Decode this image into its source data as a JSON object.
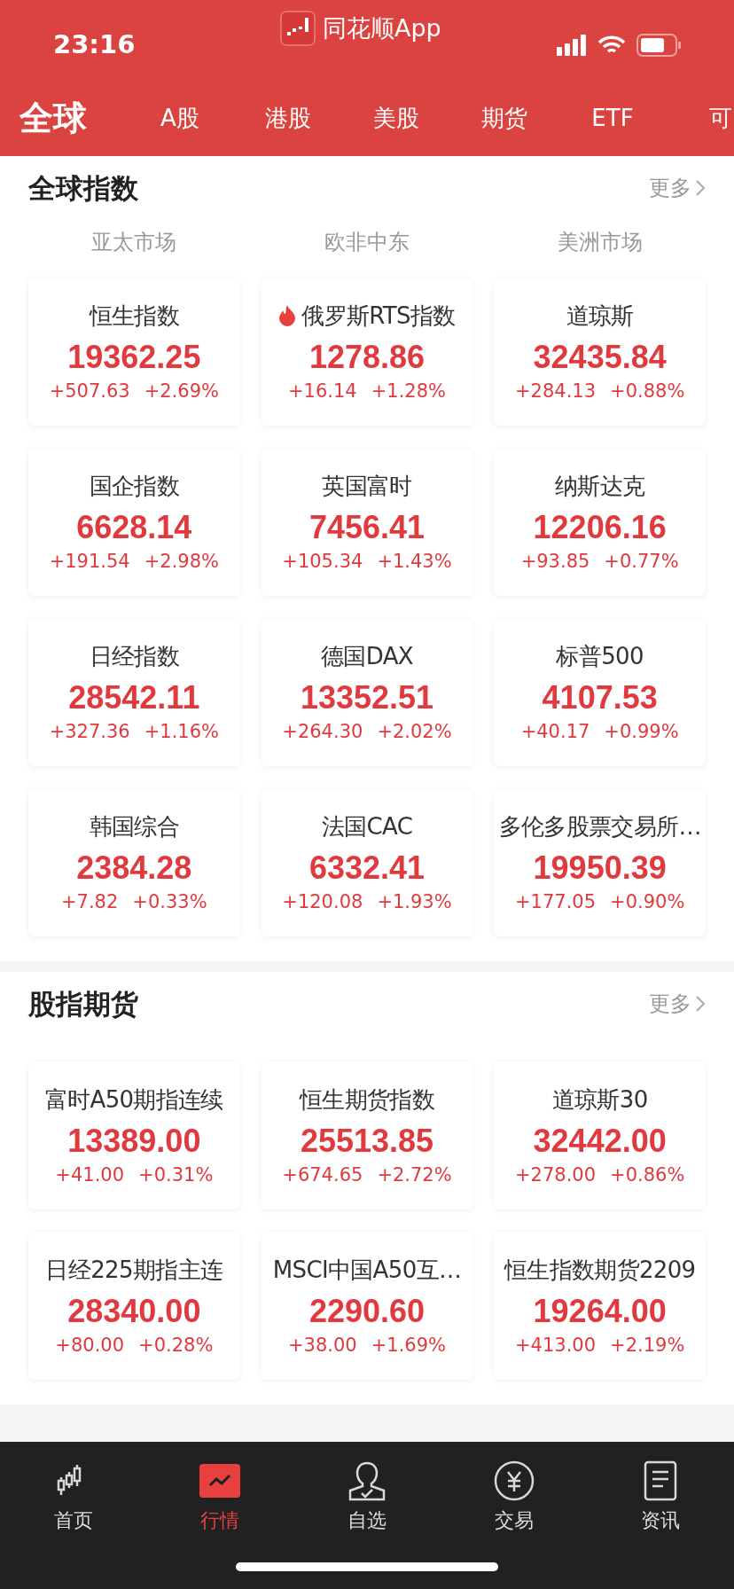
{
  "status_bar": {
    "time": "23:16",
    "app_name": "同花顺App"
  },
  "tabs": [
    {
      "label": "全球",
      "selected": true
    },
    {
      "label": "A股",
      "selected": false
    },
    {
      "label": "港股",
      "selected": false
    },
    {
      "label": "美股",
      "selected": false
    },
    {
      "label": "期货",
      "selected": false
    },
    {
      "label": "ETF",
      "selected": false
    },
    {
      "label": "可",
      "selected": false
    }
  ],
  "sections": [
    {
      "title": "全球指数",
      "more": "更多",
      "columns": [
        "亚太市场",
        "欧非中东",
        "美洲市场"
      ],
      "cards": [
        {
          "name": "恒生指数",
          "price": "19362.25",
          "change": "+507.63",
          "percent": "+2.69%",
          "hot": false
        },
        {
          "name": "俄罗斯RTS指数",
          "price": "1278.86",
          "change": "+16.14",
          "percent": "+1.28%",
          "hot": true
        },
        {
          "name": "道琼斯",
          "price": "32435.84",
          "change": "+284.13",
          "percent": "+0.88%",
          "hot": false
        },
        {
          "name": "国企指数",
          "price": "6628.14",
          "change": "+191.54",
          "percent": "+2.98%",
          "hot": false
        },
        {
          "name": "英国富时",
          "price": "7456.41",
          "change": "+105.34",
          "percent": "+1.43%",
          "hot": false
        },
        {
          "name": "纳斯达克",
          "price": "12206.16",
          "change": "+93.85",
          "percent": "+0.77%",
          "hot": false
        },
        {
          "name": "日经指数",
          "price": "28542.11",
          "change": "+327.36",
          "percent": "+1.16%",
          "hot": false
        },
        {
          "name": "德国DAX",
          "price": "13352.51",
          "change": "+264.30",
          "percent": "+2.02%",
          "hot": false
        },
        {
          "name": "标普500",
          "price": "4107.53",
          "change": "+40.17",
          "percent": "+0.99%",
          "hot": false
        },
        {
          "name": "韩国综合",
          "price": "2384.28",
          "change": "+7.82",
          "percent": "+0.33%",
          "hot": false
        },
        {
          "name": "法国CAC",
          "price": "6332.41",
          "change": "+120.08",
          "percent": "+1.93%",
          "hot": false
        },
        {
          "name": "多伦多股票交易所…",
          "price": "19950.39",
          "change": "+177.05",
          "percent": "+0.90%",
          "hot": false
        }
      ]
    },
    {
      "title": "股指期货",
      "more": "更多",
      "cards": [
        {
          "name": "富时A50期指连续",
          "price": "13389.00",
          "change": "+41.00",
          "percent": "+0.31%",
          "hot": false
        },
        {
          "name": "恒生期货指数",
          "price": "25513.85",
          "change": "+674.65",
          "percent": "+2.72%",
          "hot": false
        },
        {
          "name": "道琼斯30",
          "price": "32442.00",
          "change": "+278.00",
          "percent": "+0.86%",
          "hot": false
        },
        {
          "name": "日经225期指主连",
          "price": "28340.00",
          "change": "+80.00",
          "percent": "+0.28%",
          "hot": false
        },
        {
          "name": "MSCI中国A50互…",
          "price": "2290.60",
          "change": "+38.00",
          "percent": "+1.69%",
          "hot": false
        },
        {
          "name": "恒生指数期货2209",
          "price": "19264.00",
          "change": "+413.00",
          "percent": "+2.19%",
          "hot": false
        }
      ]
    }
  ],
  "nav": [
    {
      "label": "首页",
      "kind": "candles",
      "selected": false
    },
    {
      "label": "行情",
      "kind": "chart",
      "selected": true
    },
    {
      "label": "自选",
      "kind": "person",
      "selected": false
    },
    {
      "label": "交易",
      "kind": "yuan",
      "selected": false
    },
    {
      "label": "资讯",
      "kind": "doc",
      "selected": false
    }
  ]
}
